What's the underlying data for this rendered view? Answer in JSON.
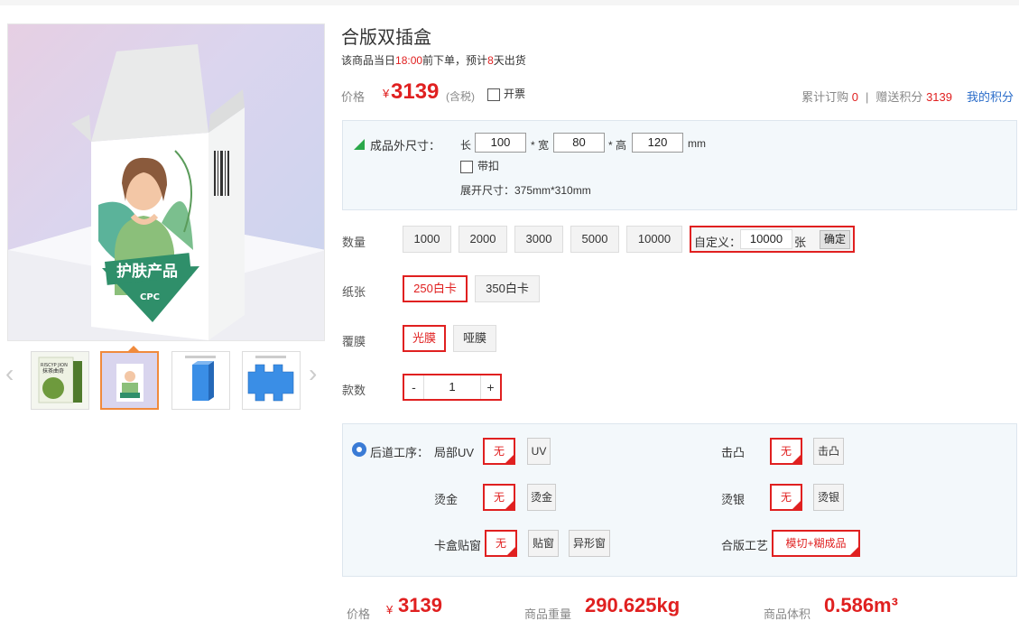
{
  "product": {
    "title": "合版双插盒",
    "shipping_note_prefix": "该商品当日",
    "shipping_cutoff": "18:00",
    "shipping_note_mid": "前下单，预计",
    "shipping_days": "8",
    "shipping_note_suffix": "天出货"
  },
  "gallery": {
    "box_brand_text": "护肤产品",
    "box_sub_text": "CPC",
    "thumb1_line1": "RISCYP JION",
    "thumb1_line2": "抹茶曲奇",
    "prev_arrow": "‹",
    "next_arrow": "›"
  },
  "price": {
    "label": "价格",
    "currency": "¥",
    "amount": "3139",
    "tax_note": "(含税)",
    "invoice_label": "开票",
    "orders_label": "累计订购",
    "orders_count": "0",
    "separator": "|",
    "points_label": "赠送积分",
    "points_value": "3139",
    "my_points_link": "我的积分"
  },
  "size": {
    "label": "成品外尺寸：",
    "length_label": "长",
    "length_value": "100",
    "width_label": "* 宽",
    "width_value": "80",
    "height_label": "* 高",
    "height_value": "120",
    "unit": "mm",
    "buckle_label": "带扣",
    "unfold_text": "展开尺寸：375mm*310mm"
  },
  "quantity": {
    "label": "数量",
    "options": [
      "1000",
      "2000",
      "3000",
      "5000",
      "10000"
    ],
    "custom_label": "自定义：",
    "custom_value": "10000",
    "custom_unit": "张",
    "confirm_label": "确定"
  },
  "paper": {
    "label": "纸张",
    "options": [
      "250白卡",
      "350白卡"
    ],
    "selected": "250白卡"
  },
  "lamination": {
    "label": "覆膜",
    "options": [
      "光膜",
      "哑膜"
    ],
    "selected": "光膜"
  },
  "styles": {
    "label": "款数",
    "minus": "-",
    "value": "1",
    "plus": "+"
  },
  "post_process": {
    "title": "后道工序：",
    "items": [
      {
        "label": "局部UV",
        "options": [
          "无",
          "UV"
        ]
      },
      {
        "label": "击凸",
        "options": [
          "无",
          "击凸"
        ]
      },
      {
        "label": "烫金",
        "options": [
          "无",
          "烫金"
        ]
      },
      {
        "label": "烫银",
        "options": [
          "无",
          "烫银"
        ]
      },
      {
        "label": "卡盒贴窗",
        "options": [
          "无",
          "贴窗",
          "异形窗"
        ]
      },
      {
        "label": "合版工艺",
        "options": [
          "模切+糊成品"
        ]
      }
    ]
  },
  "summary": {
    "price_label": "价格",
    "currency": "¥",
    "price_value": "3139",
    "weight_label": "商品重量",
    "weight_value": "290.625kg",
    "volume_label": "商品体积",
    "volume_value": "0.586m³"
  },
  "colors": {
    "accent_red": "#e02020",
    "link_blue": "#2a6cc9",
    "box_bg": "#f3f8fb",
    "thumb_active": "#f08a3c"
  }
}
